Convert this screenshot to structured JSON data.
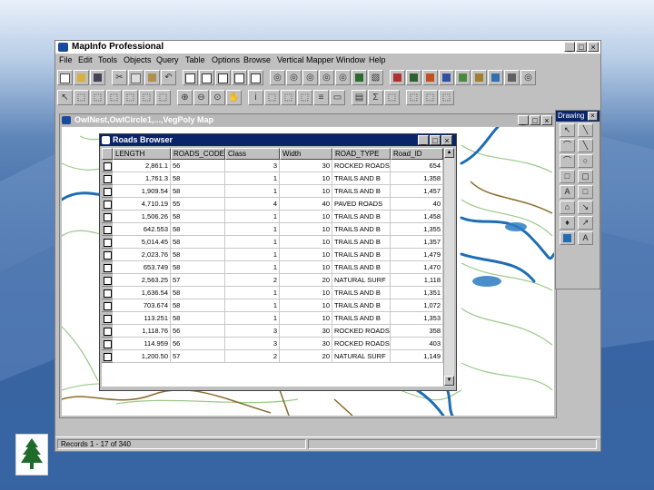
{
  "app": {
    "title": "MapInfo Professional",
    "window_controls": [
      "_",
      "□",
      "×"
    ]
  },
  "menubar": {
    "items": [
      "File",
      "Edit",
      "Tools",
      "Objects",
      "Query",
      "Table",
      "Options",
      "Browse",
      "Vertical Mapper",
      "Window",
      "Help"
    ]
  },
  "map_window": {
    "title": "OwlNest,OwlCircle1,...,VegPoly Map"
  },
  "browser": {
    "title": "Roads Browser",
    "columns": [
      "LENGTH",
      "ROADS_CODE",
      "Class",
      "Width",
      "ROAD_TYPE",
      "Road_ID"
    ],
    "rows": [
      [
        "2,861.1",
        "56",
        "3",
        "30",
        "ROCKED ROADS",
        "654"
      ],
      [
        "1,761.3",
        "58",
        "1",
        "10",
        "TRAILS AND B",
        "1,358"
      ],
      [
        "1,909.54",
        "58",
        "1",
        "10",
        "TRAILS AND B",
        "1,457"
      ],
      [
        "4,710.19",
        "55",
        "4",
        "40",
        "PAVED ROADS",
        "40"
      ],
      [
        "1,506.26",
        "58",
        "1",
        "10",
        "TRAILS AND B",
        "1,458"
      ],
      [
        "642.553",
        "58",
        "1",
        "10",
        "TRAILS AND B",
        "1,355"
      ],
      [
        "5,014.45",
        "58",
        "1",
        "10",
        "TRAILS AND B",
        "1,357"
      ],
      [
        "2,023.76",
        "58",
        "1",
        "10",
        "TRAILS AND B",
        "1,479"
      ],
      [
        "653.749",
        "58",
        "1",
        "10",
        "TRAILS AND B",
        "1,470"
      ],
      [
        "2,563.25",
        "57",
        "2",
        "20",
        "NATURAL SURF",
        "1,118"
      ],
      [
        "1,636.54",
        "58",
        "1",
        "10",
        "TRAILS AND B",
        "1,351"
      ],
      [
        "703.674",
        "58",
        "1",
        "10",
        "TRAILS AND B",
        "1,072"
      ],
      [
        "113.251",
        "58",
        "1",
        "10",
        "TRAILS AND B",
        "1,353"
      ],
      [
        "1,118.76",
        "56",
        "3",
        "30",
        "ROCKED ROADS",
        "358"
      ],
      [
        "114.959",
        "56",
        "3",
        "30",
        "ROCKED ROADS",
        "403"
      ],
      [
        "1,200.50",
        "57",
        "2",
        "20",
        "NATURAL SURF",
        "1,149"
      ]
    ]
  },
  "drawing_toolbar": {
    "title": "Drawing"
  },
  "status": {
    "records": "Records 1 - 17 of 340"
  },
  "colors": {
    "river": "#1e6db4",
    "river_fill": "#2b7cc4",
    "contour": "#9cc98a",
    "trail": "#8a6a2a",
    "title_active": "#0a246a"
  }
}
